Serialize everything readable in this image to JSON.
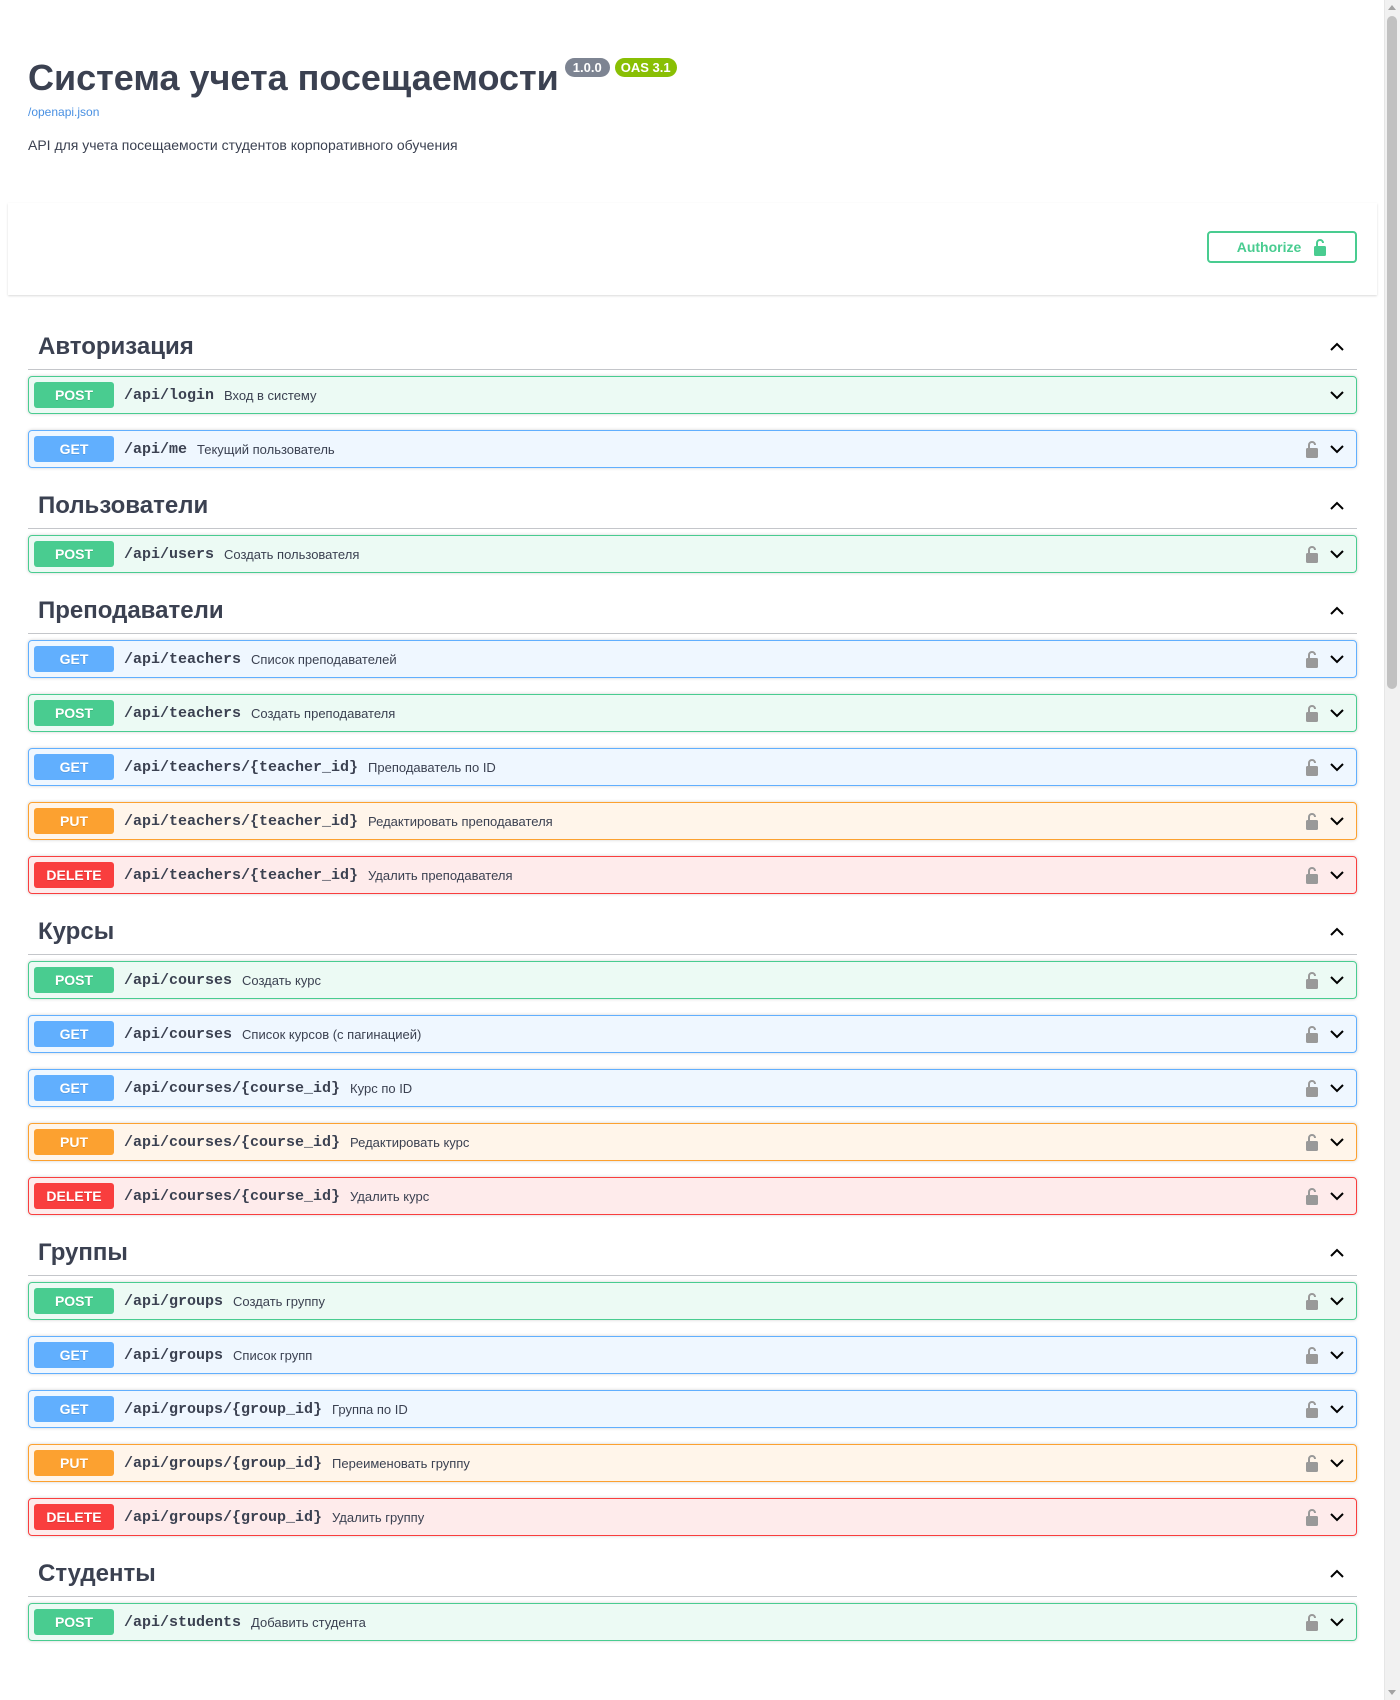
{
  "info": {
    "title": "Система учета посещаемости",
    "version": "1.0.0",
    "oas": "OAS 3.1",
    "spec_link": "/openapi.json",
    "description": "API для учета посещаемости студентов корпоративного обучения"
  },
  "authorize": {
    "label": "Authorize",
    "icon": "unlock-icon"
  },
  "colors": {
    "post": "#49cc90",
    "get": "#61affe",
    "put": "#fca130",
    "delete": "#f93e3e"
  },
  "tags": [
    {
      "name": "Авторизация",
      "slug": "auth",
      "operations": [
        {
          "method": "POST",
          "path": "/api/login",
          "summary": "Вход в систему",
          "locked": false
        },
        {
          "method": "GET",
          "path": "/api/me",
          "summary": "Текущий пользователь",
          "locked": true
        }
      ]
    },
    {
      "name": "Пользователи",
      "slug": "users",
      "operations": [
        {
          "method": "POST",
          "path": "/api/users",
          "summary": "Создать пользователя",
          "locked": true
        }
      ]
    },
    {
      "name": "Преподаватели",
      "slug": "teachers",
      "operations": [
        {
          "method": "GET",
          "path": "/api/teachers",
          "summary": "Список преподавателей",
          "locked": true
        },
        {
          "method": "POST",
          "path": "/api/teachers",
          "summary": "Создать преподавателя",
          "locked": true
        },
        {
          "method": "GET",
          "path": "/api/teachers/{teacher_id}",
          "summary": "Преподаватель по ID",
          "locked": true
        },
        {
          "method": "PUT",
          "path": "/api/teachers/{teacher_id}",
          "summary": "Редактировать преподавателя",
          "locked": true
        },
        {
          "method": "DELETE",
          "path": "/api/teachers/{teacher_id}",
          "summary": "Удалить преподавателя",
          "locked": true
        }
      ]
    },
    {
      "name": "Курсы",
      "slug": "courses",
      "operations": [
        {
          "method": "POST",
          "path": "/api/courses",
          "summary": "Создать курс",
          "locked": true
        },
        {
          "method": "GET",
          "path": "/api/courses",
          "summary": "Список курсов (с пагинацией)",
          "locked": true
        },
        {
          "method": "GET",
          "path": "/api/courses/{course_id}",
          "summary": "Курс по ID",
          "locked": true
        },
        {
          "method": "PUT",
          "path": "/api/courses/{course_id}",
          "summary": "Редактировать курс",
          "locked": true
        },
        {
          "method": "DELETE",
          "path": "/api/courses/{course_id}",
          "summary": "Удалить курс",
          "locked": true
        }
      ]
    },
    {
      "name": "Группы",
      "slug": "groups",
      "operations": [
        {
          "method": "POST",
          "path": "/api/groups",
          "summary": "Создать группу",
          "locked": true
        },
        {
          "method": "GET",
          "path": "/api/groups",
          "summary": "Список групп",
          "locked": true
        },
        {
          "method": "GET",
          "path": "/api/groups/{group_id}",
          "summary": "Группа по ID",
          "locked": true
        },
        {
          "method": "PUT",
          "path": "/api/groups/{group_id}",
          "summary": "Переименовать группу",
          "locked": true
        },
        {
          "method": "DELETE",
          "path": "/api/groups/{group_id}",
          "summary": "Удалить группу",
          "locked": true
        }
      ]
    },
    {
      "name": "Студенты",
      "slug": "students",
      "operations": [
        {
          "method": "POST",
          "path": "/api/students",
          "summary": "Добавить студента",
          "locked": true
        }
      ]
    }
  ]
}
